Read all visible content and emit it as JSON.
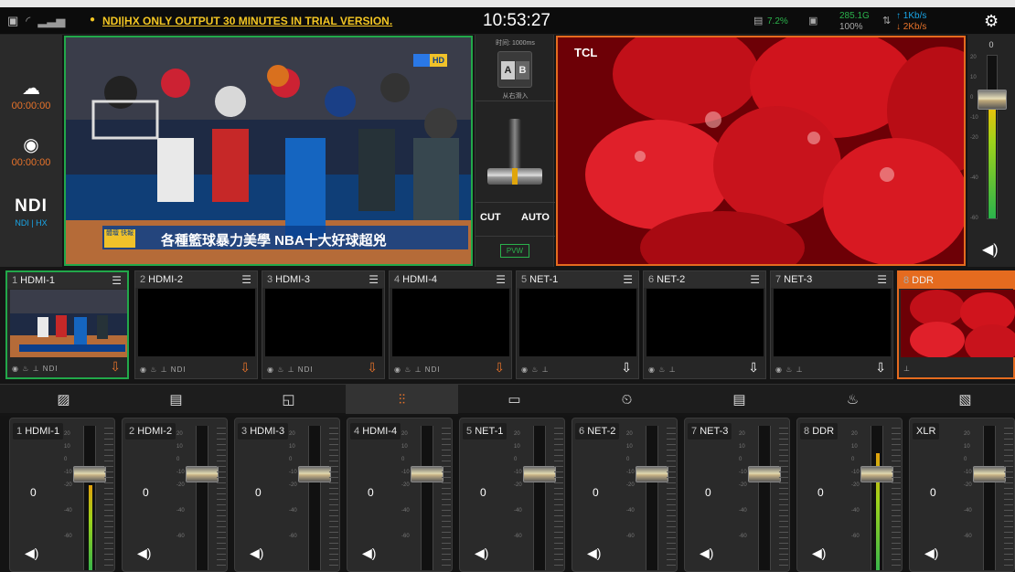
{
  "topbar": {
    "trial_text": "NDI|HX ONLY OUTPUT 30 MINUTES IN TRIAL VERSION.",
    "clock": "10:53:27",
    "storage_percent": "7.2%",
    "storage_size": "285.1G",
    "battery_percent": "100%",
    "upload": "↑ 1Kb/s",
    "download": "↓ 2Kb/s"
  },
  "left": {
    "stream_time": "00:00:00",
    "record_time": "00:00:00",
    "ndi_logo": "NDI",
    "ndi_label": "NDI | HX"
  },
  "preview": {
    "caption_tag": "體壇 快報",
    "caption": "各種籃球暴力美學 NBA十大好球超兇",
    "logo_badge": "HD"
  },
  "controls": {
    "transition_time": "时间: 1000ms",
    "ab_a": "A",
    "ab_b": "B",
    "transition_name": "从右滑入",
    "cut_label": "CUT",
    "auto_label": "AUTO",
    "pvw_label": "PVW"
  },
  "program": {
    "brand": "TCL"
  },
  "master": {
    "top_value": "0",
    "scale": [
      "20",
      "10",
      "0",
      "-10",
      "-20",
      "-40",
      "-60"
    ]
  },
  "sources": [
    {
      "num": "1",
      "name": "HDMI-1",
      "footer": "◉ ♨ ⊥ NDI"
    },
    {
      "num": "2",
      "name": "HDMI-2",
      "footer": "◉ ♨ ⊥ NDI"
    },
    {
      "num": "3",
      "name": "HDMI-3",
      "footer": "◉ ♨ ⊥ NDI"
    },
    {
      "num": "4",
      "name": "HDMI-4",
      "footer": "◉ ♨ ⊥ NDI"
    },
    {
      "num": "5",
      "name": "NET-1",
      "footer": "◉ ♨ ⊥"
    },
    {
      "num": "6",
      "name": "NET-2",
      "footer": "◉ ♨ ⊥"
    },
    {
      "num": "7",
      "name": "NET-3",
      "footer": "◉ ♨ ⊥"
    },
    {
      "num": "8",
      "name": "DDR",
      "footer": "⊥"
    }
  ],
  "tabs": [
    "image-icon",
    "overlay-icon",
    "pip-icon",
    "audio-mixer-icon",
    "media-folder-icon",
    "timer-icon",
    "notes-icon",
    "joystick-icon",
    "subtitle-icon"
  ],
  "mixer": {
    "scale": [
      "20",
      "10",
      "0",
      "-10",
      "-20",
      "-40",
      "-60"
    ],
    "channels": [
      {
        "num": "1",
        "name": "HDMI-1",
        "value": "0",
        "level": 0.62
      },
      {
        "num": "2",
        "name": "HDMI-2",
        "value": "0",
        "level": 0
      },
      {
        "num": "3",
        "name": "HDMI-3",
        "value": "0",
        "level": 0
      },
      {
        "num": "4",
        "name": "HDMI-4",
        "value": "0",
        "level": 0
      },
      {
        "num": "5",
        "name": "NET-1",
        "value": "0",
        "level": 0
      },
      {
        "num": "6",
        "name": "NET-2",
        "value": "0",
        "level": 0
      },
      {
        "num": "7",
        "name": "NET-3",
        "value": "0",
        "level": 0
      },
      {
        "num": "8",
        "name": "DDR",
        "value": "0",
        "level": 0.85
      },
      {
        "num": "",
        "name": "XLR",
        "value": "0",
        "level": 0
      }
    ]
  },
  "colors": {
    "preview_border": "#22a84a",
    "program_border": "#e56b1f",
    "accent_orange": "#e8732a",
    "ndi_blue": "#19a6e8"
  }
}
